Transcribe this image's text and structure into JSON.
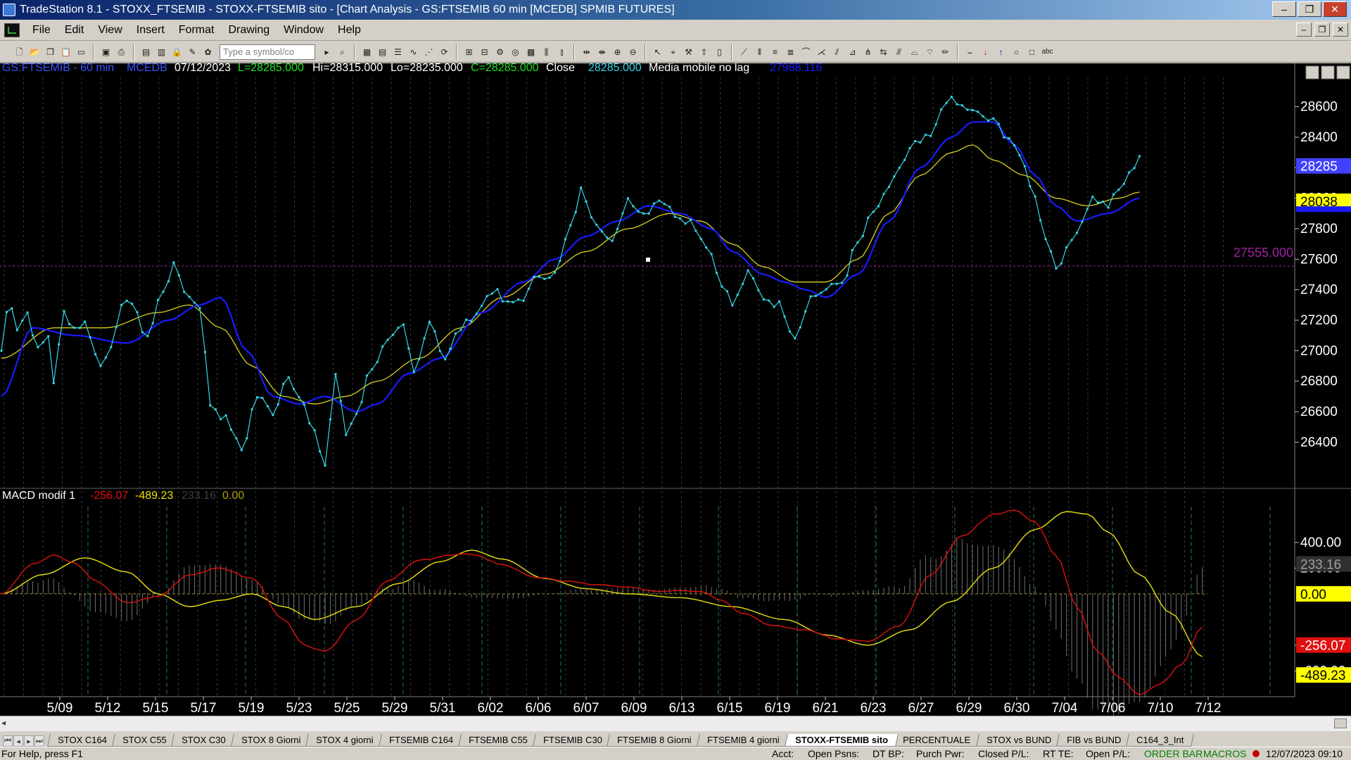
{
  "window": {
    "title": "TradeStation 8.1 - STOXX_FTSEMIB - STOXX-FTSEMIB sito - [Chart Analysis - GS:FTSEMIB  60 min  [MCEDB] SPMIB FUTURES]",
    "minimize": "‒",
    "restore": "❐",
    "close": "✕"
  },
  "menu": [
    "File",
    "Edit",
    "View",
    "Insert",
    "Format",
    "Drawing",
    "Window",
    "Help"
  ],
  "toolbar": {
    "symbol_placeholder": "Type a symbol/co"
  },
  "chart_header": {
    "symbol": "GS:FTSEMIB - 60 min",
    "exchange": "MCEDB",
    "date": "07/12/2023",
    "last": "L=28285.000",
    "high": "Hi=28315.000",
    "low": "Lo=28235.000",
    "close_c": "C=28285.000",
    "close_label": "Close",
    "close_value": "28285.000",
    "ma_label": "Media mobile no lag",
    "ma_value": "27988.116"
  },
  "price_axis": {
    "ticks": [
      "28600",
      "28400",
      "28200",
      "28000",
      "27800",
      "27600",
      "27400",
      "27200",
      "27000",
      "26800",
      "26600",
      "26400"
    ],
    "tick_values": [
      28600,
      28400,
      28200,
      28000,
      27800,
      27600,
      27400,
      27200,
      27000,
      26800,
      26600,
      26400
    ],
    "badge_close": "28285",
    "badge_ma": "28038",
    "ref_level": 27555,
    "ref_label": "27555.000"
  },
  "macd": {
    "label": "MACD modif 1",
    "v1": "-256.07",
    "v2": "-489.23",
    "v3": "233.16",
    "v4": "0.00",
    "ticks": [
      "400.00",
      "200.00",
      "-400.00",
      "-600.00"
    ],
    "tick_values": [
      400,
      200,
      -400,
      -600
    ],
    "badge_hist": "233.16",
    "badge_zero": "0.00",
    "badge_red": "-256.07",
    "badge_yellow": "-489.23"
  },
  "time_axis": [
    "5/09",
    "5/12",
    "5/15",
    "5/17",
    "5/19",
    "5/23",
    "5/25",
    "5/29",
    "5/31",
    "6/02",
    "6/06",
    "6/07",
    "6/09",
    "6/13",
    "6/15",
    "6/19",
    "6/21",
    "6/23",
    "6/27",
    "6/29",
    "6/30",
    "7/04",
    "7/06",
    "7/10",
    "7/12"
  ],
  "colors": {
    "price": "#33d6e6",
    "ma_fast": "#1a1aff",
    "ma_slow": "#d8d020",
    "macd_red": "#e01010",
    "macd_yellow": "#e8e010",
    "hist": "#707070",
    "ref": "#a020a0"
  },
  "chart_data": {
    "type": "line",
    "x_labels": [
      "5/09",
      "5/12",
      "5/15",
      "5/17",
      "5/19",
      "5/23",
      "5/25",
      "5/29",
      "5/31",
      "6/02",
      "6/06",
      "6/07",
      "6/09",
      "6/13",
      "6/15",
      "6/19",
      "6/21",
      "6/23",
      "6/27",
      "6/29",
      "6/30",
      "7/04",
      "7/06",
      "7/10",
      "7/12"
    ],
    "ylim": [
      26300,
      28700
    ],
    "price_anchors": [
      [
        0,
        27000
      ],
      [
        1,
        27250
      ],
      [
        2,
        27300
      ],
      [
        3,
        27150
      ],
      [
        5,
        27250
      ],
      [
        7,
        27000
      ],
      [
        9,
        27100
      ],
      [
        10,
        26800
      ],
      [
        12,
        27250
      ],
      [
        14,
        27150
      ],
      [
        16,
        27180
      ],
      [
        19,
        26900
      ],
      [
        21,
        27050
      ],
      [
        24,
        27350
      ],
      [
        28,
        27100
      ],
      [
        31,
        27400
      ],
      [
        33,
        27550
      ],
      [
        36,
        27350
      ],
      [
        38,
        27300
      ],
      [
        40,
        26650
      ],
      [
        43,
        26550
      ],
      [
        46,
        26350
      ],
      [
        49,
        26700
      ],
      [
        52,
        26600
      ],
      [
        55,
        26850
      ],
      [
        57,
        26700
      ],
      [
        60,
        26450
      ],
      [
        62,
        26250
      ],
      [
        64,
        26850
      ],
      [
        66,
        26450
      ],
      [
        68,
        26600
      ],
      [
        71,
        26900
      ],
      [
        74,
        27050
      ],
      [
        77,
        27150
      ],
      [
        79,
        26850
      ],
      [
        82,
        27200
      ],
      [
        85,
        26950
      ],
      [
        88,
        27150
      ],
      [
        91,
        27250
      ],
      [
        94,
        27400
      ],
      [
        97,
        27300
      ],
      [
        100,
        27350
      ],
      [
        103,
        27500
      ],
      [
        106,
        27500
      ],
      [
        109,
        27800
      ],
      [
        111,
        28050
      ],
      [
        114,
        27850
      ],
      [
        117,
        27700
      ],
      [
        120,
        28000
      ],
      [
        123,
        27900
      ],
      [
        126,
        28000
      ],
      [
        129,
        27900
      ],
      [
        132,
        27850
      ],
      [
        135,
        27700
      ],
      [
        138,
        27450
      ],
      [
        140,
        27300
      ],
      [
        143,
        27500
      ],
      [
        146,
        27350
      ],
      [
        149,
        27300
      ],
      [
        152,
        27100
      ],
      [
        155,
        27350
      ],
      [
        158,
        27400
      ],
      [
        161,
        27450
      ],
      [
        164,
        27700
      ],
      [
        167,
        27900
      ],
      [
        169,
        28000
      ],
      [
        172,
        28200
      ],
      [
        175,
        28350
      ],
      [
        178,
        28400
      ],
      [
        181,
        28650
      ],
      [
        184,
        28600
      ],
      [
        187,
        28550
      ],
      [
        190,
        28500
      ],
      [
        193,
        28400
      ],
      [
        196,
        28200
      ],
      [
        198,
        28000
      ],
      [
        200,
        27750
      ],
      [
        202,
        27550
      ],
      [
        204,
        27650
      ],
      [
        206,
        27800
      ],
      [
        209,
        28000
      ],
      [
        212,
        27950
      ],
      [
        214,
        28050
      ],
      [
        216,
        28150
      ],
      [
        218,
        28285
      ]
    ],
    "ma_fast_anchors": [
      [
        0,
        26700
      ],
      [
        6,
        27150
      ],
      [
        14,
        27100
      ],
      [
        24,
        27050
      ],
      [
        32,
        27200
      ],
      [
        38,
        27300
      ],
      [
        42,
        27350
      ],
      [
        47,
        27000
      ],
      [
        52,
        26700
      ],
      [
        57,
        26650
      ],
      [
        62,
        26700
      ],
      [
        68,
        26600
      ],
      [
        72,
        26650
      ],
      [
        78,
        26850
      ],
      [
        84,
        26950
      ],
      [
        92,
        27250
      ],
      [
        100,
        27450
      ],
      [
        106,
        27600
      ],
      [
        112,
        27750
      ],
      [
        118,
        27850
      ],
      [
        124,
        27950
      ],
      [
        130,
        27900
      ],
      [
        136,
        27800
      ],
      [
        140,
        27650
      ],
      [
        146,
        27500
      ],
      [
        150,
        27450
      ],
      [
        154,
        27400
      ],
      [
        158,
        27350
      ],
      [
        164,
        27500
      ],
      [
        170,
        27850
      ],
      [
        176,
        28200
      ],
      [
        182,
        28400
      ],
      [
        186,
        28500
      ],
      [
        190,
        28500
      ],
      [
        194,
        28350
      ],
      [
        198,
        28150
      ],
      [
        202,
        27950
      ],
      [
        206,
        27850
      ],
      [
        212,
        27900
      ],
      [
        218,
        28000
      ]
    ],
    "ma_slow_anchors": [
      [
        0,
        26950
      ],
      [
        10,
        27150
      ],
      [
        20,
        27150
      ],
      [
        30,
        27250
      ],
      [
        36,
        27300
      ],
      [
        42,
        27150
      ],
      [
        48,
        26900
      ],
      [
        54,
        26700
      ],
      [
        60,
        26650
      ],
      [
        66,
        26700
      ],
      [
        72,
        26800
      ],
      [
        80,
        26950
      ],
      [
        88,
        27150
      ],
      [
        96,
        27350
      ],
      [
        104,
        27500
      ],
      [
        112,
        27650
      ],
      [
        120,
        27800
      ],
      [
        128,
        27900
      ],
      [
        134,
        27850
      ],
      [
        140,
        27700
      ],
      [
        146,
        27550
      ],
      [
        152,
        27450
      ],
      [
        158,
        27450
      ],
      [
        164,
        27600
      ],
      [
        170,
        27900
      ],
      [
        176,
        28150
      ],
      [
        182,
        28300
      ],
      [
        186,
        28350
      ],
      [
        190,
        28250
      ],
      [
        196,
        28150
      ],
      [
        202,
        28000
      ],
      [
        208,
        27950
      ],
      [
        214,
        28000
      ],
      [
        218,
        28040
      ]
    ],
    "macd_red_anchors": [
      [
        0,
        0
      ],
      [
        6,
        230
      ],
      [
        10,
        300
      ],
      [
        14,
        240
      ],
      [
        18,
        100
      ],
      [
        24,
        -70
      ],
      [
        30,
        -20
      ],
      [
        36,
        150
      ],
      [
        42,
        200
      ],
      [
        48,
        120
      ],
      [
        54,
        -200
      ],
      [
        58,
        -400
      ],
      [
        62,
        -450
      ],
      [
        68,
        -200
      ],
      [
        74,
        100
      ],
      [
        80,
        260
      ],
      [
        86,
        300
      ],
      [
        90,
        310
      ],
      [
        96,
        230
      ],
      [
        102,
        130
      ],
      [
        108,
        100
      ],
      [
        114,
        70
      ],
      [
        120,
        50
      ],
      [
        126,
        20
      ],
      [
        130,
        30
      ],
      [
        134,
        20
      ],
      [
        138,
        -50
      ],
      [
        142,
        -150
      ],
      [
        148,
        -250
      ],
      [
        154,
        -280
      ],
      [
        160,
        -350
      ],
      [
        166,
        -370
      ],
      [
        172,
        -250
      ],
      [
        178,
        150
      ],
      [
        184,
        450
      ],
      [
        190,
        620
      ],
      [
        194,
        650
      ],
      [
        198,
        560
      ],
      [
        202,
        300
      ],
      [
        206,
        -100
      ],
      [
        210,
        -450
      ],
      [
        214,
        -650
      ],
      [
        218,
        -780
      ],
      [
        222,
        -700
      ],
      [
        226,
        -550
      ],
      [
        230,
        -256
      ]
    ],
    "macd_yellow_anchors": [
      [
        0,
        0
      ],
      [
        8,
        150
      ],
      [
        16,
        280
      ],
      [
        24,
        170
      ],
      [
        30,
        0
      ],
      [
        36,
        -100
      ],
      [
        42,
        -50
      ],
      [
        48,
        0
      ],
      [
        54,
        -100
      ],
      [
        60,
        -200
      ],
      [
        68,
        -100
      ],
      [
        76,
        80
      ],
      [
        84,
        250
      ],
      [
        90,
        340
      ],
      [
        96,
        270
      ],
      [
        104,
        120
      ],
      [
        112,
        40
      ],
      [
        120,
        0
      ],
      [
        130,
        -30
      ],
      [
        140,
        -100
      ],
      [
        150,
        -200
      ],
      [
        158,
        -320
      ],
      [
        166,
        -400
      ],
      [
        174,
        -280
      ],
      [
        182,
        -60
      ],
      [
        190,
        200
      ],
      [
        198,
        500
      ],
      [
        204,
        640
      ],
      [
        208,
        620
      ],
      [
        212,
        480
      ],
      [
        218,
        150
      ],
      [
        224,
        -150
      ],
      [
        230,
        -489
      ]
    ],
    "macd_ylim": [
      -800,
      700
    ]
  },
  "tabs": [
    "STOX C164",
    "STOX C55",
    "STOX  C30",
    "STOX  8 Giorni",
    "STOX 4 giorni",
    "FTSEMIB C164",
    "FTSEMIB C55",
    "FTSEMIB C30",
    "FTSEMIB  8 Giorni",
    "FTSEMIB  4 giorni",
    "STOXX-FTSEMIB sito",
    "PERCENTUALE",
    "STOX vs BUND",
    "FIB vs BUND",
    "C164_3_Int"
  ],
  "active_tab": "STOXX-FTSEMIB sito",
  "status": {
    "help": "For Help, press F1",
    "acct": "Acct:",
    "open_psns": "Open Psns:",
    "dt_bp": "DT BP:",
    "purch_pwr": "Purch Pwr:",
    "closed_pl": "Closed P/L:",
    "rt_te": "RT TE:",
    "open_pl": "Open P/L:",
    "order_bar": "ORDER BAR",
    "macros": "MACROS",
    "datetime": "12/07/2023 09:10"
  }
}
